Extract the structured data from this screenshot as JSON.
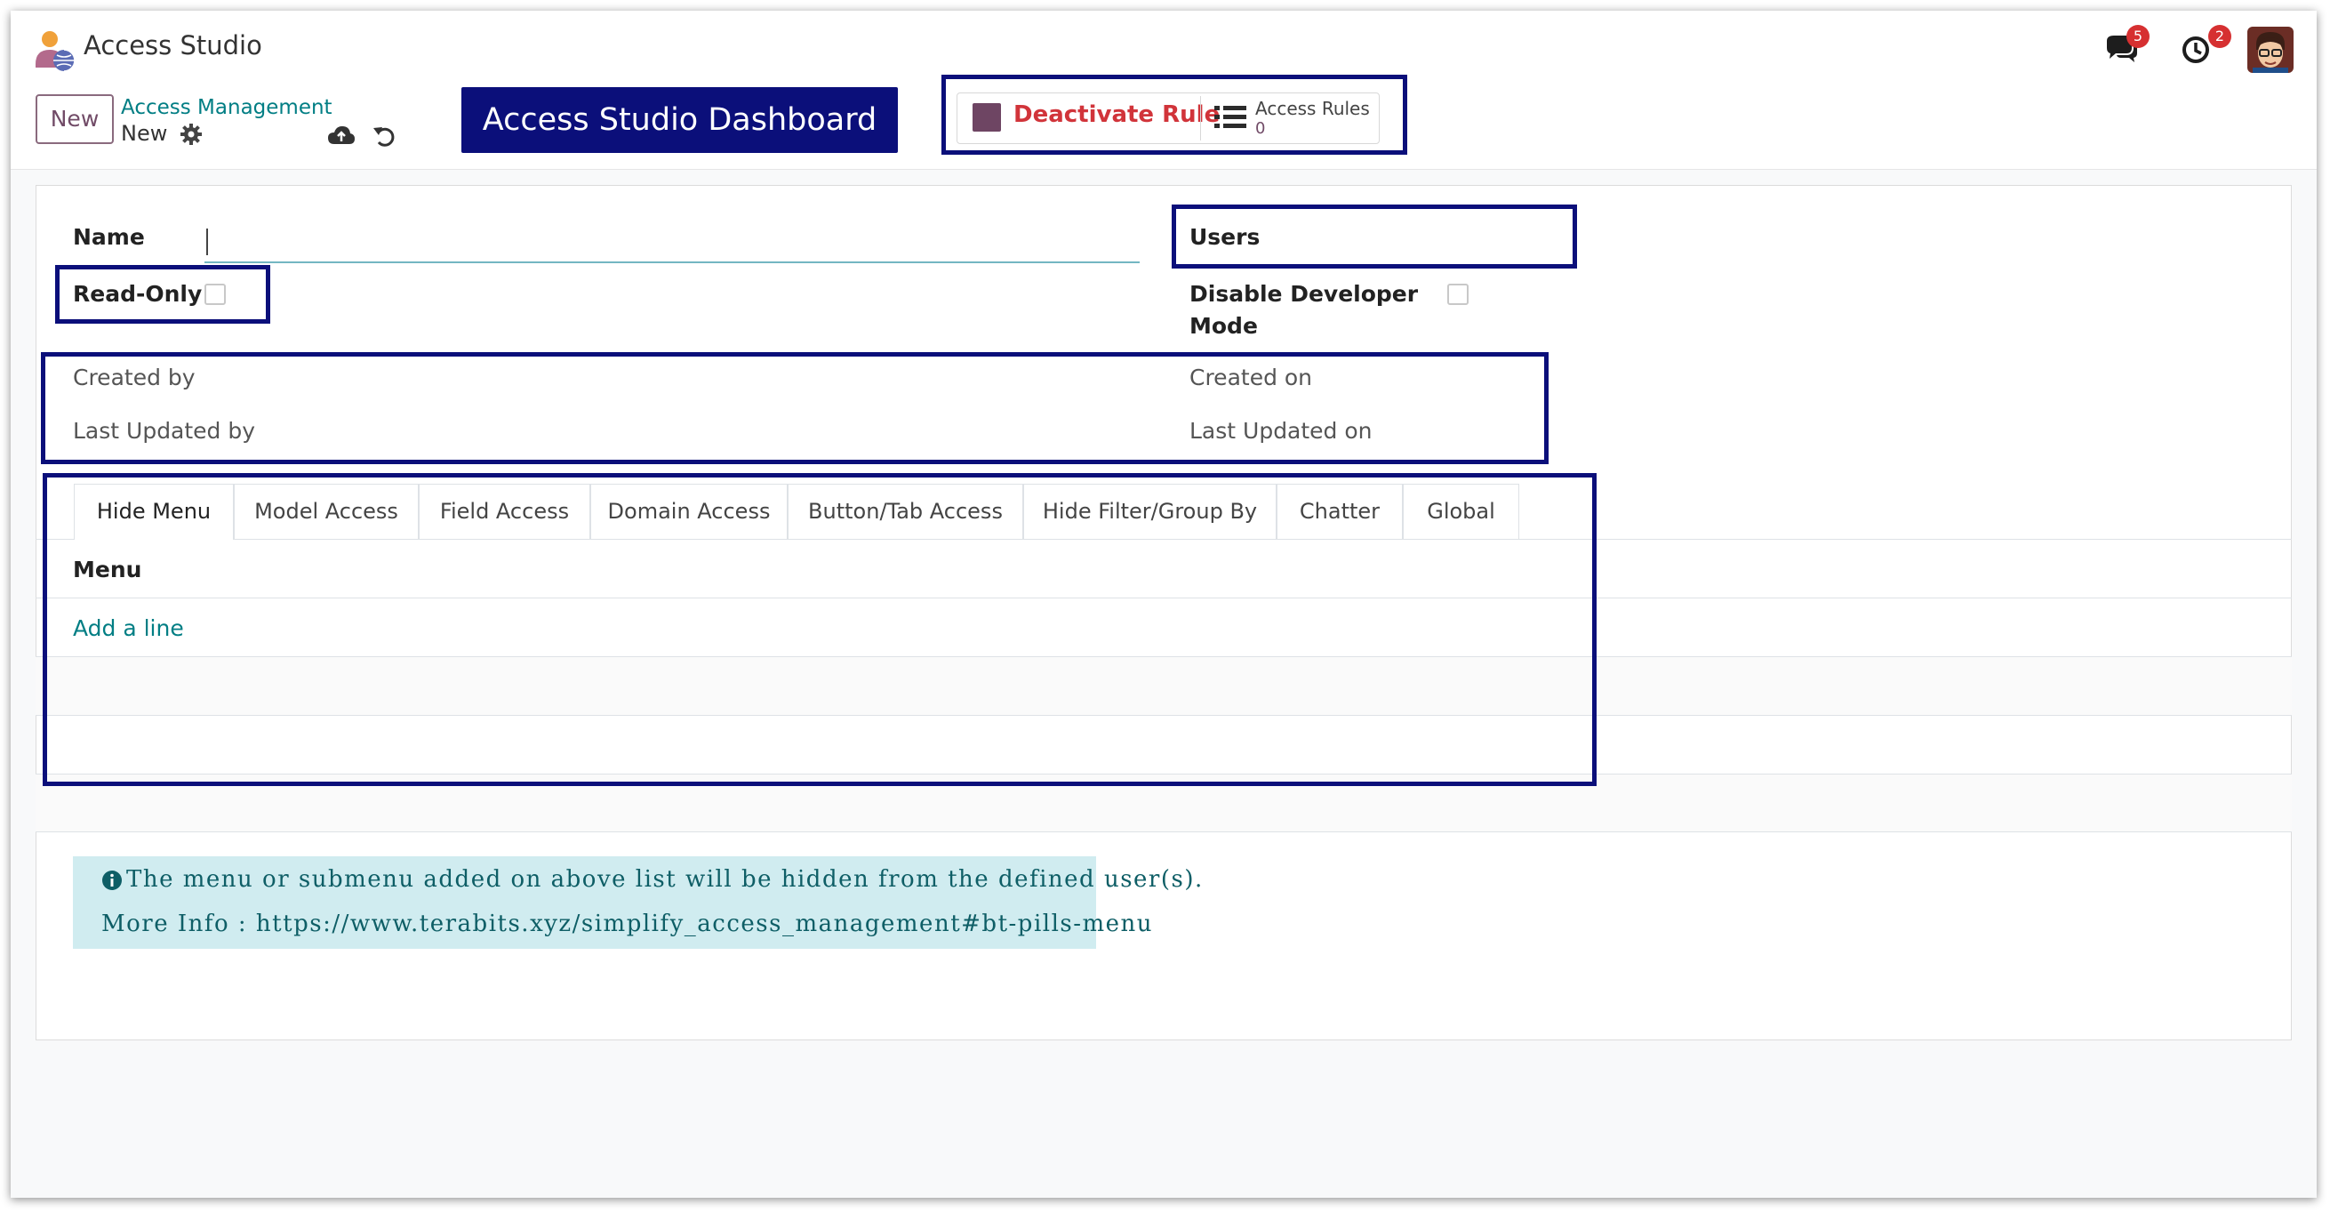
{
  "app": {
    "title": "Access Studio"
  },
  "systray": {
    "messages_count": "5",
    "activities_count": "2"
  },
  "control_panel": {
    "new_label": "New",
    "breadcrumb_parent": "Access Management",
    "breadcrumb_current": "New",
    "dashboard_label": "Access Studio Dashboard",
    "smart_buttons": {
      "deactivate_label": "Deactivate Rule",
      "access_rules_label": "Access Rules",
      "access_rules_count": "0"
    }
  },
  "form": {
    "name_label": "Name",
    "name_value": "",
    "readonly_label": "Read-Only",
    "users_label": "Users",
    "disable_dev_label_line1": "Disable Developer",
    "disable_dev_label_line2": "Mode",
    "created_by_label": "Created by",
    "last_updated_by_label": "Last Updated by",
    "created_on_label": "Created on",
    "last_updated_on_label": "Last Updated on"
  },
  "tabs": [
    {
      "label": "Hide Menu",
      "active": true
    },
    {
      "label": "Model Access"
    },
    {
      "label": "Field Access"
    },
    {
      "label": "Domain Access"
    },
    {
      "label": "Button/Tab Access"
    },
    {
      "label": "Hide Filter/Group By"
    },
    {
      "label": "Chatter"
    },
    {
      "label": "Global"
    }
  ],
  "menu_list": {
    "column_header": "Menu",
    "add_line_label": "Add a line"
  },
  "info": {
    "line1": "The menu or submenu added on above list will be hidden from the defined user(s).",
    "line2": "More Info : https://www.terabits.xyz/simplify_access_management#bt-pills-menu"
  },
  "colors": {
    "brand": "#714b67",
    "accent": "#017e84",
    "highlight_outline": "#0b0f7a",
    "danger": "#d1343a"
  }
}
